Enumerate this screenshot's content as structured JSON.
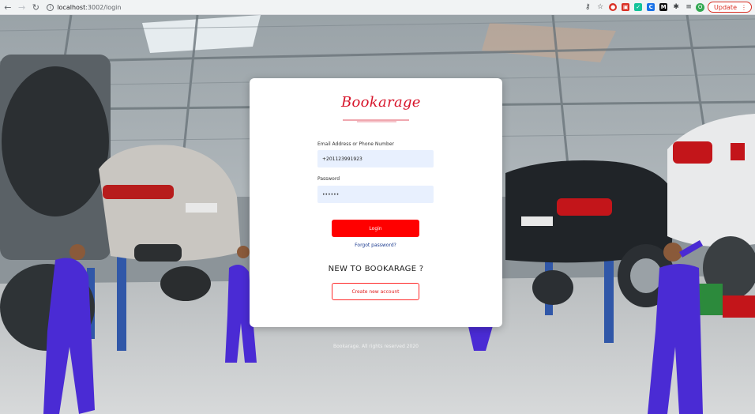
{
  "browser": {
    "url_host": "localhost",
    "url_path": ":3002/login",
    "update_label": "Update",
    "profile_initial": "O",
    "extensions": [
      {
        "name": "key-icon",
        "glyph": "⚷",
        "color": "transparent"
      },
      {
        "name": "star-icon",
        "glyph": "☆",
        "color": "transparent"
      },
      {
        "name": "record-extension-icon",
        "glyph": "●",
        "color": "#d93025"
      },
      {
        "name": "pdf-extension-icon",
        "glyph": "▣",
        "color": "#d93025"
      },
      {
        "name": "grammar-extension-icon",
        "glyph": "✓",
        "color": "#15c39a"
      },
      {
        "name": "c-extension-icon",
        "glyph": "C",
        "color": "#1a73e8"
      },
      {
        "name": "m-extension-icon",
        "glyph": "M",
        "color": "#111111"
      },
      {
        "name": "puzzle-extension-icon",
        "glyph": "✱",
        "color": "transparent"
      },
      {
        "name": "reading-list-icon",
        "glyph": "≡",
        "color": "transparent"
      }
    ]
  },
  "login": {
    "logo_text": "Bookarage",
    "email_label": "Email Address or Phone Number",
    "email_value": "+201123991923",
    "password_label": "Password",
    "password_value": "••••••",
    "login_button": "Login",
    "forgot_link": "Forgot password?",
    "new_heading": "NEW TO BOOKARAGE ?",
    "create_button": "Create new account"
  },
  "footer": {
    "copyright": "Bookarage. All rights reserved 2020"
  },
  "colors": {
    "brand_red": "#ff0000",
    "logo_red": "#d7142a",
    "input_bg": "#e8f0fe",
    "link_blue": "#1a3a8f"
  }
}
